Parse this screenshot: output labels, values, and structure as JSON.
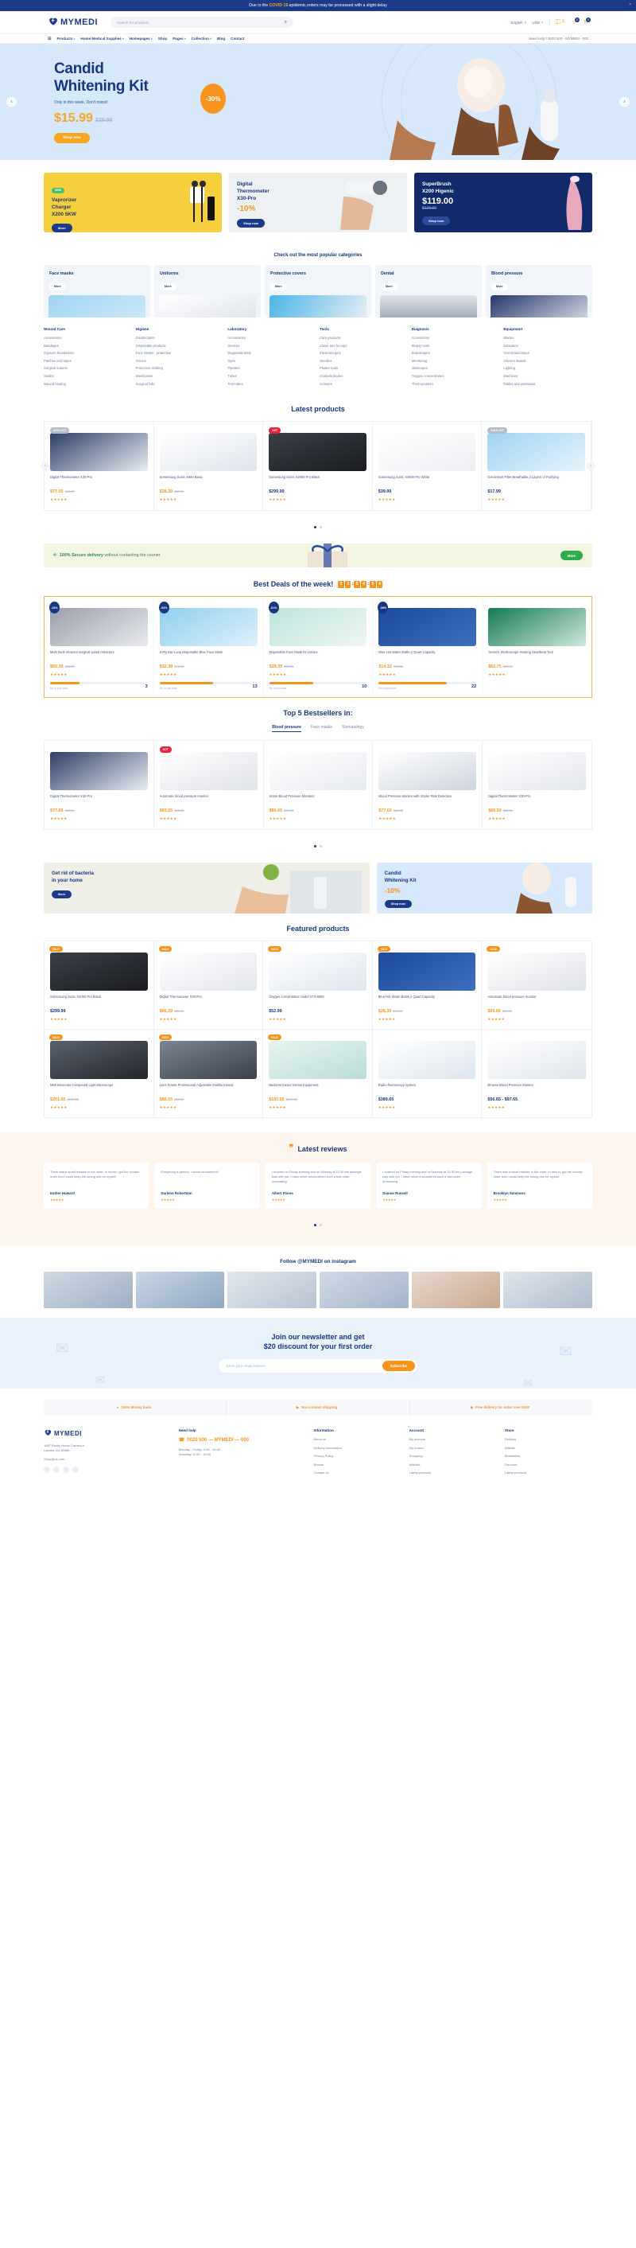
{
  "topbar": {
    "text_before": "Due to the ",
    "highlight": "COVID 19",
    "text_after": " epidemic,orders may be processed with a slight delay",
    "close": "×"
  },
  "header": {
    "brand": "MYMEDI",
    "search_placeholder": "Search for products",
    "search_icon": "⌕",
    "language": "English",
    "currency": "USD",
    "wishlist_count": "0",
    "cart_count": "0"
  },
  "nav": {
    "items": [
      "Products",
      "Home Medical Supplies",
      "Homepages",
      "Shop",
      "Pages",
      "Collection",
      "Blog",
      "Contact"
    ],
    "caret": [
      "v",
      "v",
      "v",
      "",
      "v",
      "v",
      "",
      ""
    ],
    "help": "Need help? 0020 500 - MYMEDI - 000"
  },
  "hero": {
    "title_line1": "Candid",
    "title_line2": "Whitening Kit",
    "subtitle": "Only in this week. Don't misss!",
    "price": "$15.99",
    "old_price": "$29.99",
    "cta": "Shop now",
    "discount": "-30%",
    "prev": "‹",
    "next": "›"
  },
  "promos": [
    {
      "tag": "NEW",
      "title": "Vaprorizer\nCharger\nX200 5KW",
      "cta": "More"
    },
    {
      "title": "Digital\nThermometer\nX30-Pro",
      "discount": "-10%",
      "cta": "Shop now"
    },
    {
      "title": "SuperBrush\nX200 Higenic",
      "price": "$119.00",
      "old_price": "$129.00",
      "cta": "Shop now"
    }
  ],
  "categories": {
    "title": "Check out the most popular categories",
    "items": [
      {
        "label": "Face masks",
        "cta": "More",
        "color": "#b9ddf5"
      },
      {
        "label": "Uniforms",
        "cta": "More",
        "color": "#e6e9ee"
      },
      {
        "label": "Protective covers",
        "cta": "More",
        "color": "#7fc9ea"
      },
      {
        "label": "Dental",
        "cta": "More",
        "color": "#c5cbd6"
      },
      {
        "label": "Blood pressure",
        "cta": "More",
        "color": "#20336b"
      }
    ]
  },
  "linkcols": [
    {
      "heading": "Wound Care",
      "links": [
        "Accessories",
        "Bandages",
        "Gypsum foundations",
        "Patches and tapes",
        "Surgical sutures",
        "Swabs",
        "Wound healing"
      ]
    },
    {
      "heading": "Higiene",
      "links": [
        "Disinfectants",
        "Disposable products",
        "Face Masks - protective",
        "Gloves",
        "Protective clothing",
        "Sterilization",
        "Surgical foils"
      ]
    },
    {
      "heading": "Laboratory",
      "links": [
        "Accessories",
        "Devices",
        "Diagnostic tests",
        "Dyes",
        "Pipettes",
        "Tubes",
        "Test-tubes"
      ]
    },
    {
      "heading": "Tools",
      "links": [
        "Care products",
        "Claws and forceps",
        "Electrosurgery",
        "Needles",
        "Plaster tools",
        "Scalpels,blades",
        "Scissors"
      ]
    },
    {
      "heading": "Diagnosis",
      "links": [
        "Accessories",
        "Biopsy tools",
        "Endoscopes",
        "Monitoring",
        "Otoscopes",
        "Oxygen concentrators",
        "Thermometers"
      ]
    },
    {
      "heading": "Equipment",
      "links": [
        "Blades",
        "Education",
        "Germicidal lamps",
        "Infusion stands",
        "Lighting",
        "Machines",
        "Tables and assistants"
      ]
    }
  ],
  "latest": {
    "title": "Latest products",
    "products": [
      {
        "badge": "SOLD OUT",
        "badge_type": "soldout",
        "name": "Digital Thermometer X30-Pro",
        "price": "$77.65",
        "old_price": "$80.65",
        "stars": "★★★★★",
        "color": "#2d3f66"
      },
      {
        "name": "Somersung Sonic X500 Basic",
        "price": "$38.39",
        "old_price": "$53.99",
        "stars": "★★★★★",
        "color": "#dfe4ec"
      },
      {
        "badge": "HOT",
        "badge_type": "hot",
        "name": "Somersung Sonic X2000 Pro Black",
        "price": "$299.99",
        "stars": "★★★★★",
        "color": "#23262b"
      },
      {
        "name": "Somersung Sonic X2500 Pro White",
        "price": "$39.99",
        "stars": "★★★★★",
        "color": "#eceef2"
      },
      {
        "badge": "SOLD OUT",
        "badge_type": "soldout",
        "name": "GAnti-Dust Filter,Breathable,3 Layers of Purifying",
        "price": "$17.99",
        "stars": "★★★★★",
        "color": "#bfdff2"
      }
    ]
  },
  "secure": {
    "bold": "100% Secure delivery",
    "rest": " without contacting the courier",
    "cta": "More",
    "icon": "shield-check-icon"
  },
  "deals": {
    "title": "Best Deals of the week!",
    "timer": [
      "2",
      "3",
      ":",
      "5",
      "4",
      ":",
      "5",
      "4"
    ],
    "products": [
      {
        "off": "-26%",
        "name": "Multi hook retractor surgical spinal retractors",
        "price": "$65.39",
        "old_price": "$89.99",
        "stars": "★★★★★",
        "sold_label": "No of pcs sold:",
        "sold": "3",
        "bar": 30,
        "color": "#6f7580"
      },
      {
        "off": "-54%",
        "name": "3-Ply Ear-Loop Disposable Blue Face Mask",
        "price": "$32.39",
        "old_price": "$71.99",
        "stars": "★★★★★",
        "sold_label": "No of pcs sold:",
        "sold": "13",
        "bar": 55,
        "color": "#8fd0ee"
      },
      {
        "off": "-61%",
        "name": "Disposable Face Mask for Unisex",
        "price": "$29.39",
        "old_price": "$59.99",
        "stars": "★★★★★",
        "sold_label": "No of pcs sold:",
        "sold": "10",
        "bar": 45,
        "color": "#bfe3db"
      },
      {
        "off": "-30%",
        "name": "Blue Hot Water Bottle,2 Quart Capacity",
        "price": "$14.32",
        "old_price": "$15.32",
        "stars": "★★★★★",
        "sold_label": "No of pcs sold:",
        "sold": "22",
        "bar": 70,
        "color": "#1d4a9a"
      },
      {
        "name": "Generic Stethoscope Hearing Heartbeat Tool",
        "price": "$62.75",
        "old_price": "$69.99",
        "stars": "★★★★★",
        "color": "#157a52"
      }
    ]
  },
  "bestsellers": {
    "title": "Top 5 Bestsellers in:",
    "tabs": [
      "Blood pressure",
      "Face masks",
      "Stomatology"
    ],
    "active_tab": 0,
    "products": [
      {
        "name": "Digital Thermometer X30-Pro",
        "price": "$77.65",
        "old_price": "$80.65",
        "stars": "★★★★★",
        "color": "#2d3f66"
      },
      {
        "badge": "HOT",
        "badge_type": "hot",
        "name": "Automatic blood pressure monitor",
        "price": "$93.65",
        "old_price": "$99.99",
        "stars": "★★★★★",
        "color": "#dfe2e7"
      },
      {
        "name": "Home Blood Pressure Monitors",
        "price": "$86.65",
        "old_price": "$99.99",
        "stars": "★★★★★",
        "color": "#e7eaef"
      },
      {
        "name": "Blood Pressure Monitor with Stroke Risk Detection",
        "price": "$77.65",
        "old_price": "$89.99",
        "stars": "★★★★★",
        "color": "#cfd5de"
      },
      {
        "name": "Digital Thermometer X30-Pro",
        "price": "$66.39",
        "old_price": "$89.99",
        "stars": "★★★★★",
        "color": "#e3e6ec"
      }
    ]
  },
  "banners": [
    {
      "title": "Get rid of bacteria\nin your home",
      "cta": "More"
    },
    {
      "title": "Candid\nWhitening Kit",
      "discount": "-10%",
      "cta": "Shop now"
    }
  ],
  "featured": {
    "title": "Featured products",
    "products": [
      {
        "tag": "SALE",
        "name": "Somersung Sonic X2000 Pro Black",
        "price": "$299.99",
        "stars": "★★★★★",
        "color": "#23262b"
      },
      {
        "tag": "SALE",
        "name": "Digital Thermometer X30-Pro",
        "price": "$66.39",
        "old_price": "$89.99",
        "stars": "★★★★★",
        "color": "#e3e6ec"
      },
      {
        "tag": "SALE",
        "name": "Oxygen concentrator model XT3-8000",
        "price": "$52.99",
        "stars": "★★★★★",
        "color": "#dfe6ef"
      },
      {
        "tag": "SALE",
        "name": "Blue Hot Water Bottle,2 Quart Capacity",
        "price": "$28.39",
        "old_price": "$33.99",
        "stars": "★★★★★",
        "color": "#1d4a9a"
      },
      {
        "tag": "SALE",
        "name": "Automatic blood pressure monitor",
        "price": "$93.65",
        "old_price": "$99.99",
        "stars": "★★★★★",
        "color": "#dfe2e7"
      },
      {
        "tag": "SALE",
        "name": "M58 Binocular Compound Light Microscope",
        "price": "$201.65",
        "old_price": "$249.65",
        "stars": "★★★★★",
        "color": "#2b2f38"
      },
      {
        "tag": "SALE",
        "name": "Lens Frame Professional Adjustable Multifunctional",
        "price": "$89.65",
        "old_price": "$99.99",
        "stars": "★★★★★",
        "color": "#4c5563"
      },
      {
        "tag": "SALE",
        "name": "Backrest Easier Dental Equipment",
        "price": "$197.65",
        "old_price": "$249.65",
        "stars": "★★★★★",
        "color": "#cfe6e2"
      },
      {
        "name": "Radio-fluoroscopy system",
        "price": "$389.65",
        "stars": "★★★★★",
        "color": "#dde6ee"
      },
      {
        "name": "Browse Blood Pressure Monitor",
        "price": "$56.65 - $97.65",
        "stars": "★★★★★",
        "color": "#e0e5ec"
      }
    ]
  },
  "reviews": {
    "title": "Latest reviews",
    "quote_icon": "quote-icon",
    "items": [
      {
        "text": "There was a small mistake in the order. In return,I got the contact order and I could keep the wrong one for myself.",
        "author": "Esther Howard",
        "stars": "★★★★★"
      },
      {
        "text": "Everything is perfect, I would recommend!",
        "author": "Darlene Robertson",
        "stars": "★★★★★"
      },
      {
        "text": "I ordered on Friday evening and on Monday at 12:30 the package was with me. I have never encountered such a fast order processing.",
        "author": "Albert Flores",
        "stars": "★★★★★"
      },
      {
        "text": "I ordered on Friday evening and on Monday at 12:30 the package was with me. I have never encountered such a fast order processing.",
        "author": "Dianne Russell",
        "stars": "★★★★★"
      },
      {
        "text": "There was a small mistake in the order. In return,I got the contact order and I could keep the wrong one for myself.",
        "author": "Brooklyn Simmons",
        "stars": "★★★★★"
      }
    ]
  },
  "instagram": {
    "title": "Follow @MYMEDI on instagram",
    "tiles": [
      "#d8dfe8",
      "#c9d6e4",
      "#e2e7ee",
      "#d1dae6",
      "#e7d8cf",
      "#dfe5ec"
    ]
  },
  "newsletter": {
    "line1": "Join our newsletter and get",
    "line2": "$20 discount for your first order",
    "placeholder": "Enter your email address",
    "cta": "Subscribe"
  },
  "trust": [
    {
      "icon": "money-icon",
      "label": "100% Money back"
    },
    {
      "icon": "truck-icon",
      "label": "Non-contact shipping"
    },
    {
      "icon": "gift-icon",
      "label": "Free delivery for order over $200"
    }
  ],
  "footer": {
    "brand": "MYMEDI",
    "address": "1487 Rocky Horse Carrefour\nLatrobe CA 36985",
    "email_label": "Shop@us.com",
    "need_help": "Need help",
    "phone": "0020 500 — MYMEDI — 000",
    "hours": "Monday - Friday: 9:00 - 20:00\nSaturday 11:00 - 15:00",
    "columns": [
      {
        "heading": "Information",
        "links": [
          "About us",
          "Delivery information",
          "Privacy Policy",
          "Brands",
          "Contact us"
        ]
      },
      {
        "heading": "Account",
        "links": [
          "My account",
          "My orders",
          "Shopping",
          "Wishlist",
          "Latest products"
        ]
      },
      {
        "heading": "Store",
        "links": [
          "Delivery",
          "Affiliate",
          "Bestsellers",
          "Discount",
          "Latest products"
        ]
      }
    ]
  },
  "colors": {
    "navy": "#17377f",
    "orange": "#f7941e",
    "green": "#2faa4d",
    "lightblue": "#d6e8fa"
  }
}
